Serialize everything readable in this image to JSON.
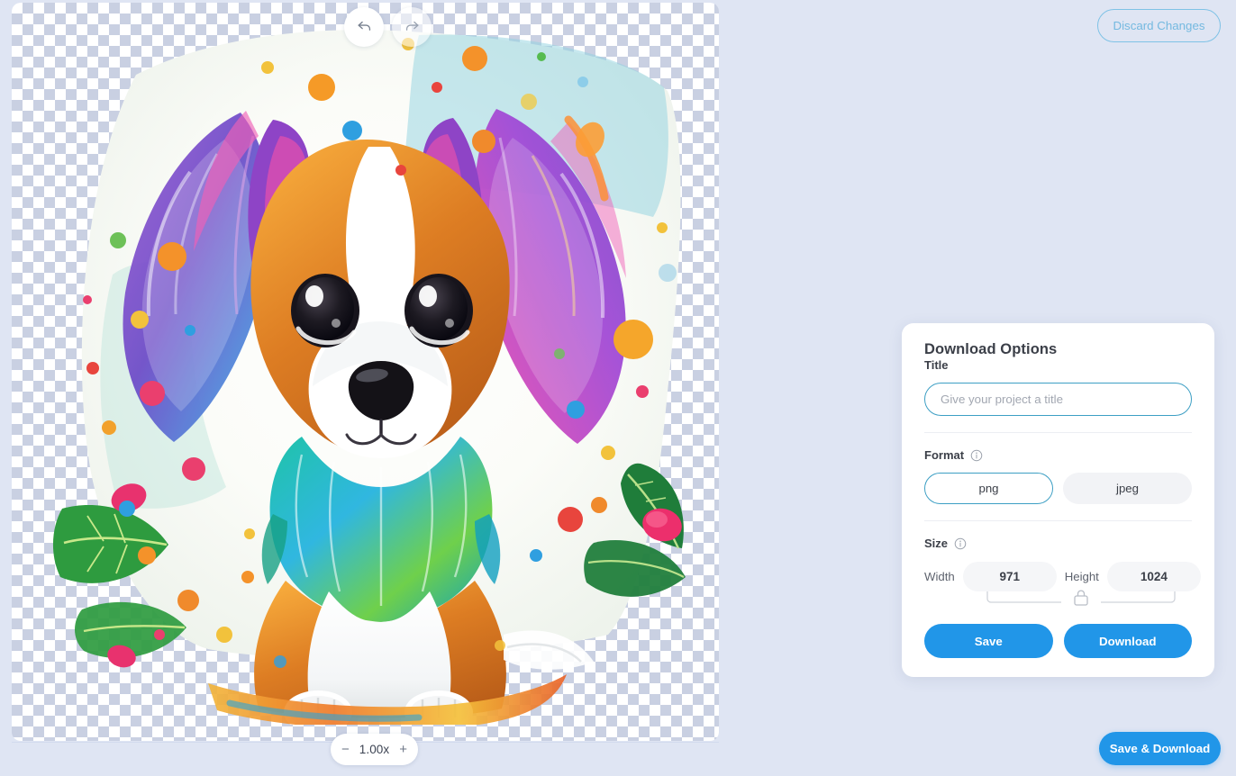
{
  "header": {
    "discard_label": "Discard Changes"
  },
  "canvas": {
    "undo_icon": "undo-arrow-icon",
    "redo_icon": "redo-arrow-icon",
    "zoom": {
      "minus": "−",
      "level": "1.00x",
      "plus": "+"
    },
    "artwork_alt": "watercolor puppy with butterfly wings illustration"
  },
  "panel": {
    "title": "Download Options",
    "title_field": {
      "label": "Title",
      "value": "",
      "placeholder": "Give your project a title"
    },
    "format": {
      "label": "Format",
      "info_icon": "info-icon",
      "options": [
        {
          "label": "png",
          "selected": true
        },
        {
          "label": "jpeg",
          "selected": false
        }
      ]
    },
    "size": {
      "label": "Size",
      "info_icon": "info-icon",
      "width_label": "Width",
      "width_value": "971",
      "height_label": "Height",
      "height_value": "1024",
      "lock_icon": "lock-closed-icon"
    },
    "actions": {
      "save": "Save",
      "download": "Download"
    }
  },
  "footer": {
    "save_download": "Save & Download"
  },
  "colors": {
    "page_bg": "#dfe5f3",
    "accent_blue": "#2196e8",
    "outline_blue": "#3d9fc4",
    "disabled_blue": "#74b9e0",
    "text_dark": "#3b3f48"
  }
}
